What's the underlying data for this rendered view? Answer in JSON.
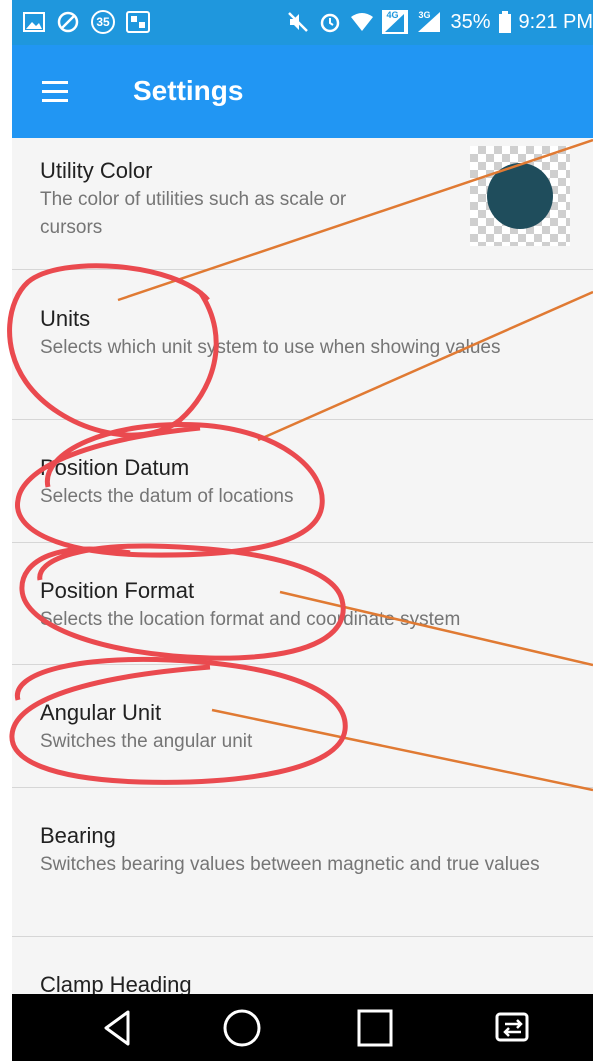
{
  "status_bar": {
    "notification_count": "35",
    "battery": "35%",
    "time": "9:21 PM",
    "network_4g": "4G",
    "network_3g": "3G"
  },
  "app_bar": {
    "title": "Settings"
  },
  "settings": [
    {
      "title": "Utility Color",
      "subtitle": "The color of utilities such as scale or cursors"
    },
    {
      "title": "Units",
      "subtitle": "Selects which unit system to use when showing values"
    },
    {
      "title": "Position Datum",
      "subtitle": "Selects the datum of locations"
    },
    {
      "title": "Position Format",
      "subtitle": "Selects the location format and coordinate system"
    },
    {
      "title": "Angular Unit",
      "subtitle": "Switches the angular unit"
    },
    {
      "title": "Bearing",
      "subtitle": "Switches bearing values between magnetic and true values"
    },
    {
      "title": "Clamp Heading",
      "subtitle": ""
    }
  ],
  "colors": {
    "status_bar": "#1f97dd",
    "app_bar": "#2196f3",
    "utility_swatch": "#1f4d5c",
    "annotation_circle": "#ea4a4f",
    "annotation_line": "#e07a33"
  }
}
